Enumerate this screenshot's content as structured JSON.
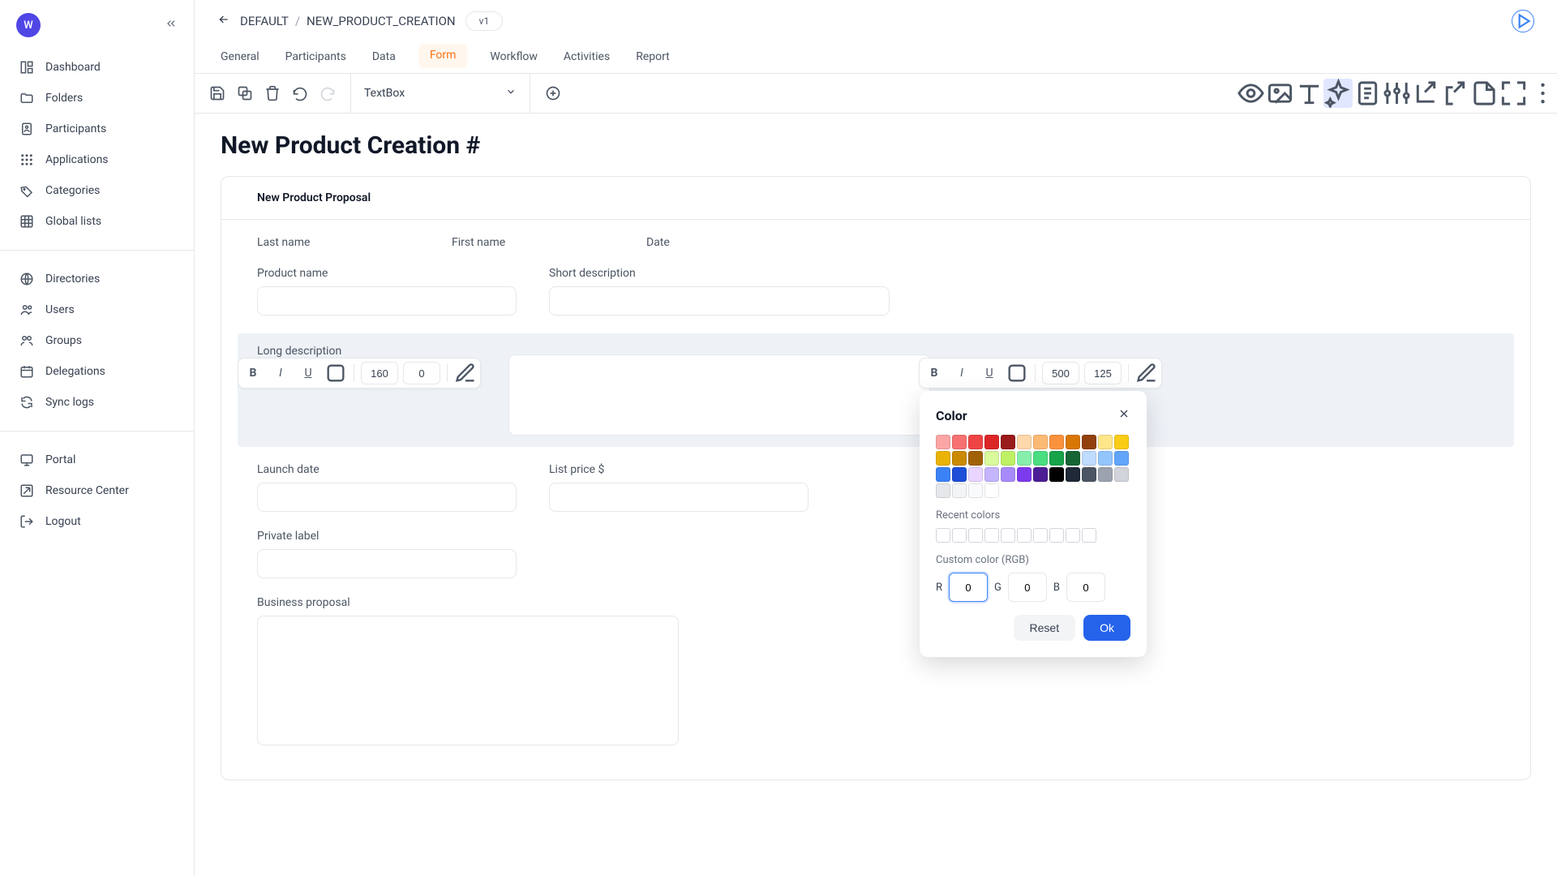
{
  "avatar": {
    "initial": "W"
  },
  "sidebar": {
    "group1": [
      {
        "label": "Dashboard"
      },
      {
        "label": "Folders"
      },
      {
        "label": "Participants"
      },
      {
        "label": "Applications"
      },
      {
        "label": "Categories"
      },
      {
        "label": "Global lists"
      }
    ],
    "group2": [
      {
        "label": "Directories"
      },
      {
        "label": "Users"
      },
      {
        "label": "Groups"
      },
      {
        "label": "Delegations"
      },
      {
        "label": "Sync logs"
      }
    ],
    "group3": [
      {
        "label": "Portal"
      },
      {
        "label": "Resource Center"
      },
      {
        "label": "Logout"
      }
    ]
  },
  "breadcrumb": {
    "root": "DEFAULT",
    "leaf": "NEW_PRODUCT_CREATION",
    "version": "v1"
  },
  "tabs": [
    {
      "label": "General"
    },
    {
      "label": "Participants"
    },
    {
      "label": "Data"
    },
    {
      "label": "Form"
    },
    {
      "label": "Workflow"
    },
    {
      "label": "Activities"
    },
    {
      "label": "Report"
    }
  ],
  "toolbar": {
    "block_type": "TextBox"
  },
  "form": {
    "title": "New Product Creation #",
    "section": "New Product Proposal",
    "fields": {
      "last_name": "Last name",
      "first_name": "First name",
      "date": "Date",
      "product_name": "Product name",
      "short_description": "Short description",
      "long_description": "Long description",
      "launch_date": "Launch date",
      "list_price": "List price $",
      "private_label": "Private label",
      "business_proposal": "Business proposal"
    }
  },
  "mini_toolbar_left": {
    "w": "160",
    "h": "0"
  },
  "mini_toolbar_right": {
    "w": "500",
    "h": "125"
  },
  "color_popover": {
    "title": "Color",
    "recent_label": "Recent colors",
    "custom_label": "Custom color (RGB)",
    "r_label": "R",
    "g_label": "G",
    "b_label": "B",
    "r": "0",
    "g": "0",
    "b": "0",
    "reset": "Reset",
    "ok": "Ok",
    "palette": [
      "#fca5a5",
      "#f87171",
      "#ef4444",
      "#dc2626",
      "#991b1b",
      "#fed7aa",
      "#fdba74",
      "#fb923c",
      "#d97706",
      "#92400e",
      "#fde68a",
      "#facc15",
      "#eab308",
      "#ca8a04",
      "#a16207",
      "#d9f99d",
      "#bef264",
      "#86efac",
      "#4ade80",
      "#16a34a",
      "#166534",
      "#bfdbfe",
      "#93c5fd",
      "#60a5fa",
      "#3b82f6",
      "#1d4ed8",
      "#e9d5ff",
      "#c4b5fd",
      "#a78bfa",
      "#7c3aed",
      "#4c1d95",
      "#000000",
      "#1f2937",
      "#4b5563",
      "#9ca3af",
      "#d1d5db",
      "#e5e7eb",
      "#f3f4f6",
      "#f9fafb",
      "#ffffff"
    ]
  }
}
